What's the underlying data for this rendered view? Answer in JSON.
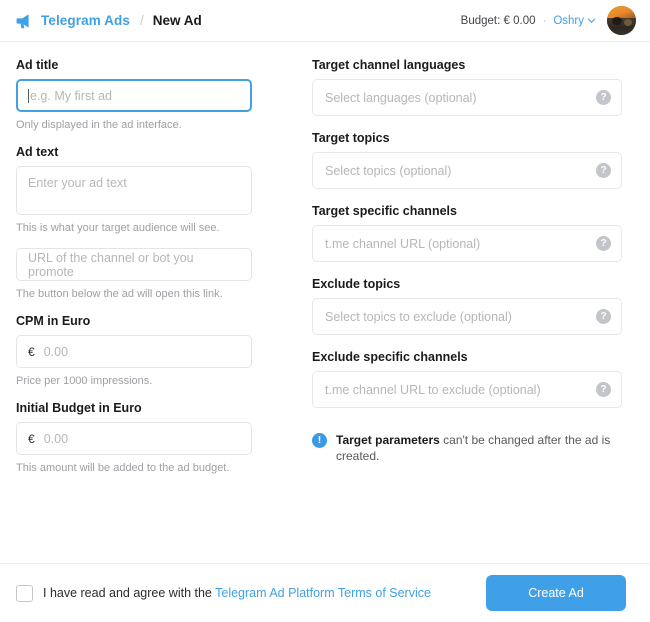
{
  "header": {
    "brand_label": "Telegram Ads",
    "breadcrumb_separator": "/",
    "current_page": "New Ad",
    "budget_text": "Budget: € 0.00",
    "dot_separator": "·",
    "user_name": "Oshry",
    "brand_color": "#3fa0e8"
  },
  "left_column": {
    "ad_title": {
      "label": "Ad title",
      "placeholder": "e.g. My first ad",
      "value": "",
      "hint": "Only displayed in the ad interface.",
      "focused": true
    },
    "ad_text": {
      "label": "Ad text",
      "placeholder": "Enter your ad text",
      "value": "",
      "hint": "This is what your target audience will see."
    },
    "ad_url": {
      "placeholder": "URL of the channel or bot you promote",
      "value": "",
      "hint": "The button below the ad will open this link."
    },
    "cpm": {
      "label": "CPM in Euro",
      "currency": "€",
      "placeholder": "0.00",
      "value": "",
      "hint": "Price per 1000 impressions."
    },
    "initial_budget": {
      "label": "Initial Budget in Euro",
      "currency": "€",
      "placeholder": "0.00",
      "value": "",
      "hint": "This amount will be added to the ad budget."
    }
  },
  "right_column": {
    "target_languages": {
      "label": "Target channel languages",
      "placeholder": "Select languages (optional)",
      "value": "",
      "help_glyph": "?"
    },
    "target_topics": {
      "label": "Target topics",
      "placeholder": "Select topics (optional)",
      "value": "",
      "help_glyph": "?"
    },
    "target_channels": {
      "label": "Target specific channels",
      "placeholder": "t.me channel URL (optional)",
      "value": "",
      "help_glyph": "?"
    },
    "exclude_topics": {
      "label": "Exclude topics",
      "placeholder": "Select topics to exclude (optional)",
      "value": "",
      "help_glyph": "?"
    },
    "exclude_channels": {
      "label": "Exclude specific channels",
      "placeholder": "t.me channel URL to exclude (optional)",
      "value": "",
      "help_glyph": "?"
    },
    "note": {
      "icon_glyph": "!",
      "bold_text": "Target parameters",
      "rest_text": " can't be changed after the ad is created.",
      "icon_color": "#3b9ae8"
    }
  },
  "footer": {
    "agree_text": "I have read and agree with the",
    "terms_link": "Telegram Ad Platform Terms of Service",
    "checkbox_checked": false,
    "create_button": "Create Ad",
    "button_color": "#40a0e7"
  }
}
